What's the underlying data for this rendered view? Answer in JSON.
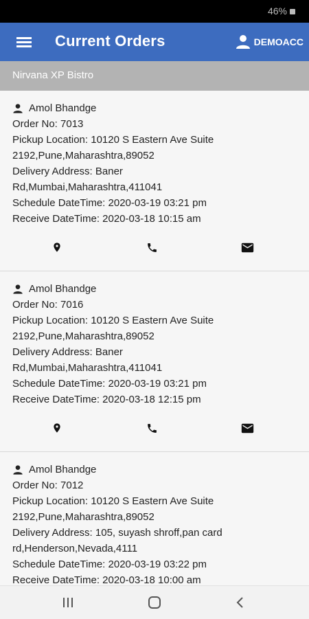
{
  "status": {
    "battery": "46%"
  },
  "header": {
    "title": "Current Orders",
    "account": "DEMOACC"
  },
  "restaurant": {
    "name": "Nirvana XP Bistro"
  },
  "orders": [
    {
      "customer": "Amol Bhandge",
      "order_no": "Order No: 7013",
      "pickup_1": "Pickup Location: 10120 S Eastern Ave Suite",
      "pickup_2": "2192,Pune,Maharashtra,89052",
      "delivery_1": "Delivery Address: Baner",
      "delivery_2": "Rd,Mumbai,Maharashtra,411041",
      "schedule": "Schedule DateTime: 2020-03-19 03:21 pm",
      "receive": "Receive DateTime: 2020-03-18 10:15 am"
    },
    {
      "customer": "Amol Bhandge",
      "order_no": "Order No: 7016",
      "pickup_1": "Pickup Location: 10120 S Eastern Ave Suite",
      "pickup_2": "2192,Pune,Maharashtra,89052",
      "delivery_1": "Delivery Address: Baner",
      "delivery_2": "Rd,Mumbai,Maharashtra,411041",
      "schedule": "Schedule DateTime: 2020-03-19 03:21 pm",
      "receive": "Receive DateTime: 2020-03-18 12:15 pm"
    },
    {
      "customer": "Amol Bhandge",
      "order_no": "Order No: 7012",
      "pickup_1": "Pickup Location: 10120 S Eastern Ave Suite",
      "pickup_2": "2192,Pune,Maharashtra,89052",
      "delivery_1": "Delivery Address: 105, suyash shroff,pan card",
      "delivery_2": "rd,Henderson,Nevada,4111",
      "schedule": "Schedule DateTime: 2020-03-19 03:22 pm",
      "receive": "Receive DateTime: 2020-03-18 10:00 am"
    }
  ],
  "icons": {
    "menu": "hamburger-menu-icon",
    "account": "person-icon",
    "location": "location-pin-icon",
    "call": "phone-icon",
    "email": "email-icon"
  },
  "colors": {
    "app_bar": "#3d6cbf",
    "sub_bar": "#b3b3b3"
  }
}
